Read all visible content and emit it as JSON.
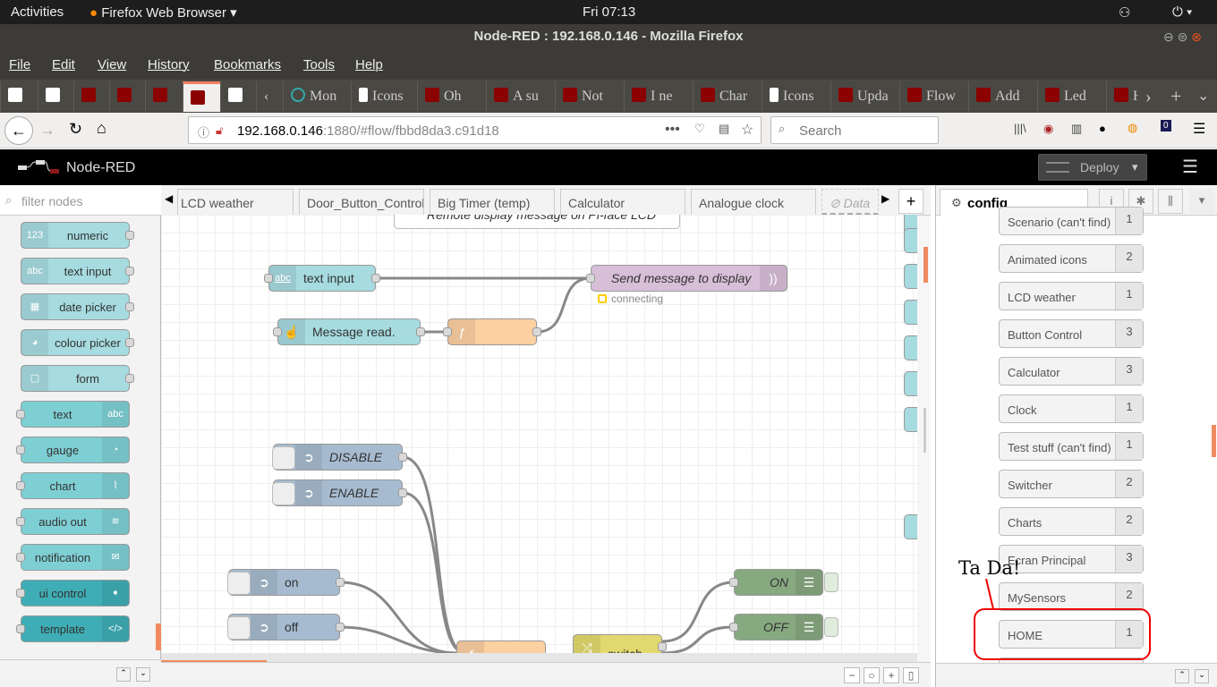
{
  "system": {
    "activities": "Activities",
    "app": "Firefox Web Browser",
    "clock": "Fri 07:13"
  },
  "window": {
    "title": "Node-RED : 192.168.0.146 - Mozilla Firefox"
  },
  "menu": [
    "File",
    "Edit",
    "View",
    "History",
    "Bookmarks",
    "Tools",
    "Help"
  ],
  "browser_tabs": [
    "Mon",
    "Icons",
    "Oh",
    "A su",
    "Not",
    "I ne",
    "Char",
    "Icons",
    "Upda",
    "Flow",
    "Add",
    "Led",
    "H"
  ],
  "url": {
    "host": "192.168.0.146",
    "rest": ":1880/#flow/fbbd8da3.c91d18",
    "search_placeholder": "Search",
    "badge": "0"
  },
  "header": {
    "title": "Node-RED",
    "deploy": "Deploy"
  },
  "palette": {
    "filter_placeholder": "filter nodes",
    "nodes": [
      "numeric",
      "text input",
      "date picker",
      "colour picker",
      "form",
      "text",
      "gauge",
      "chart",
      "audio out",
      "notification",
      "ui control",
      "template"
    ],
    "icons": [
      "123",
      "abc",
      "▦",
      "◕",
      "▢",
      "abc",
      "◔",
      "⌇",
      "≋",
      "✉",
      "➧",
      "</>"
    ]
  },
  "flow_tabs": [
    "LCD weather",
    "Door_Button_Control",
    "Big Timer (temp)",
    "Calculator",
    "Analogue clock",
    "Data"
  ],
  "flow": {
    "comment": "Remote display message on Pi-face LCD",
    "text_input": "text input",
    "send": "Send message to display",
    "status": "connecting",
    "message_read": "Message read.",
    "disable": "DISABLE",
    "enable": "ENABLE",
    "on": "on",
    "off": "off",
    "ON": "ON",
    "OFF": "OFF",
    "switch": "switch"
  },
  "sidebar": {
    "tab": "config",
    "items": [
      {
        "name": "Scenario (can't find)",
        "count": "1"
      },
      {
        "name": "Animated icons",
        "count": "2"
      },
      {
        "name": "LCD weather",
        "count": "1"
      },
      {
        "name": "Button Control",
        "count": "3"
      },
      {
        "name": "Calculator",
        "count": "3"
      },
      {
        "name": "Clock",
        "count": "1"
      },
      {
        "name": "Test stuff (can't find)",
        "count": "1"
      },
      {
        "name": "Switcher",
        "count": "2"
      },
      {
        "name": "Charts",
        "count": "2"
      },
      {
        "name": "Ecran Principal",
        "count": "3"
      },
      {
        "name": "MySensors",
        "count": "2"
      },
      {
        "name": "HOME",
        "count": "1"
      }
    ]
  },
  "annotation": "Ta Da!"
}
